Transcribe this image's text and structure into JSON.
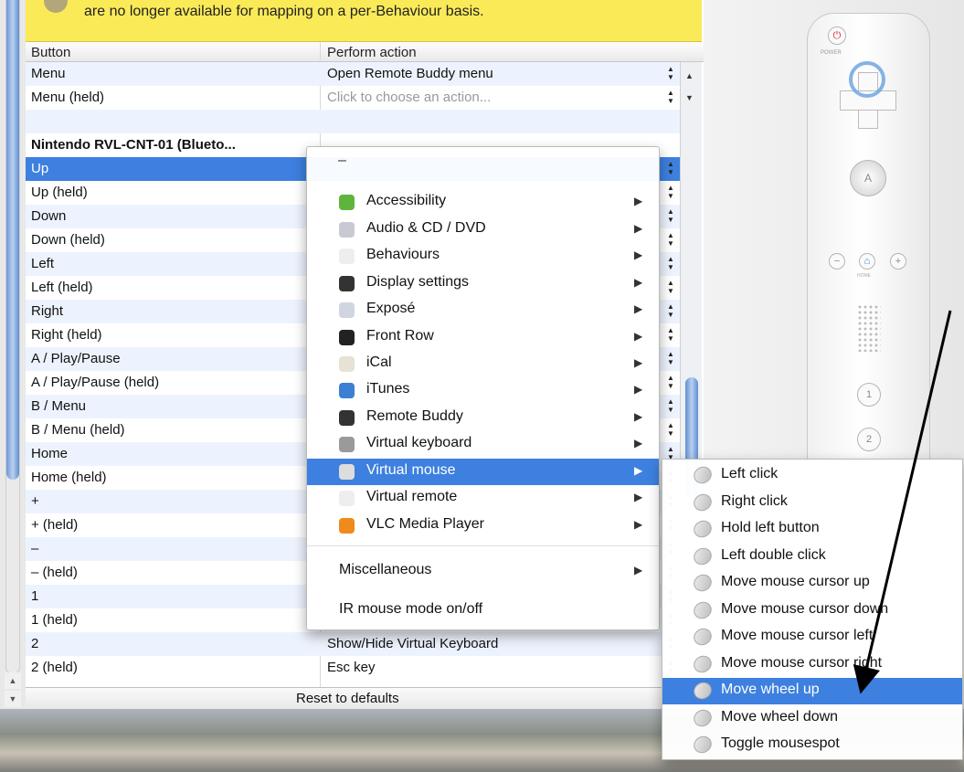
{
  "banner": {
    "text": "are no longer available for mapping on a per-Behaviour basis."
  },
  "table": {
    "header": {
      "col1": "Button",
      "col2": "Perform action"
    },
    "rows": [
      {
        "button": "Menu",
        "action": "Open Remote Buddy menu"
      },
      {
        "button": "Menu (held)",
        "action": "Click to choose an action..."
      },
      {
        "button": "",
        "action": ""
      },
      {
        "button": "Nintendo RVL-CNT-01 (Blueto...",
        "action": ""
      },
      {
        "button": "Up",
        "action": ""
      },
      {
        "button": "Up (held)",
        "action": ""
      },
      {
        "button": "Down",
        "action": ""
      },
      {
        "button": "Down (held)",
        "action": ""
      },
      {
        "button": "Left",
        "action": ""
      },
      {
        "button": "Left (held)",
        "action": ""
      },
      {
        "button": "Right",
        "action": ""
      },
      {
        "button": "Right (held)",
        "action": ""
      },
      {
        "button": "A / Play/Pause",
        "action": ""
      },
      {
        "button": "A / Play/Pause (held)",
        "action": ""
      },
      {
        "button": "B / Menu",
        "action": ""
      },
      {
        "button": "B / Menu (held)",
        "action": ""
      },
      {
        "button": "Home",
        "action": ""
      },
      {
        "button": "Home (held)",
        "action": ""
      },
      {
        "button": "+",
        "action": ""
      },
      {
        "button": "+ (held)",
        "action": ""
      },
      {
        "button": "–",
        "action": ""
      },
      {
        "button": "– (held)",
        "action": ""
      },
      {
        "button": "1",
        "action": ""
      },
      {
        "button": "1 (held)",
        "action": ""
      },
      {
        "button": "2",
        "action": "Show/Hide Virtual Keyboard"
      },
      {
        "button": "2 (held)",
        "action": "Esc key"
      }
    ]
  },
  "footer": {
    "reset_label": "Reset to defaults"
  },
  "menu": {
    "dash": "–",
    "items": [
      {
        "label": "Accessibility",
        "icon": "accessibility-icon",
        "color": "#5fb53c"
      },
      {
        "label": "Audio & CD / DVD",
        "icon": "cd-icon",
        "color": "#c9c9d4"
      },
      {
        "label": "Behaviours",
        "icon": "headphones-icon",
        "color": "#eeeeee"
      },
      {
        "label": "Display settings",
        "icon": "display-icon",
        "color": "#333333"
      },
      {
        "label": "Exposé",
        "icon": "expose-icon",
        "color": "#cfd6e0"
      },
      {
        "label": "Front Row",
        "icon": "front-row-icon",
        "color": "#222222"
      },
      {
        "label": "iCal",
        "icon": "ical-icon",
        "color": "#e7e2d6"
      },
      {
        "label": "iTunes",
        "icon": "itunes-icon",
        "color": "#3c7fd4"
      },
      {
        "label": "Remote Buddy",
        "icon": "remote-buddy-icon",
        "color": "#333333"
      },
      {
        "label": "Virtual keyboard",
        "icon": "keyboard-icon",
        "color": "#9a9a9a"
      },
      {
        "label": "Virtual mouse",
        "icon": "mouse-icon",
        "color": "#dddddd"
      },
      {
        "label": "Virtual remote",
        "icon": "remote-icon",
        "color": "#eeeeee"
      },
      {
        "label": "VLC Media Player",
        "icon": "vlc-cone-icon",
        "color": "#f08a1c"
      },
      {
        "label": "Miscellaneous",
        "icon": "",
        "color": ""
      },
      {
        "label": "IR mouse mode on/off",
        "icon": "",
        "color": ""
      }
    ]
  },
  "submenu": {
    "items": [
      {
        "label": "Left click"
      },
      {
        "label": "Right click"
      },
      {
        "label": "Hold left button"
      },
      {
        "label": "Left double click"
      },
      {
        "label": "Move mouse cursor up"
      },
      {
        "label": "Move mouse cursor down"
      },
      {
        "label": "Move mouse cursor left"
      },
      {
        "label": "Move mouse cursor right"
      },
      {
        "label": "Move wheel up"
      },
      {
        "label": "Move wheel down"
      },
      {
        "label": "Toggle mousespot"
      }
    ]
  },
  "wii": {
    "power_label": "POWER",
    "home_label": "HOME",
    "a": "A",
    "one": "1",
    "two": "2",
    "minus": "−",
    "plus": "+",
    "home": "⌂",
    "power": "⏻"
  },
  "colors": {
    "banner": "#faea58",
    "selection": "#3d80df",
    "alt_row": "#edf3fe"
  }
}
